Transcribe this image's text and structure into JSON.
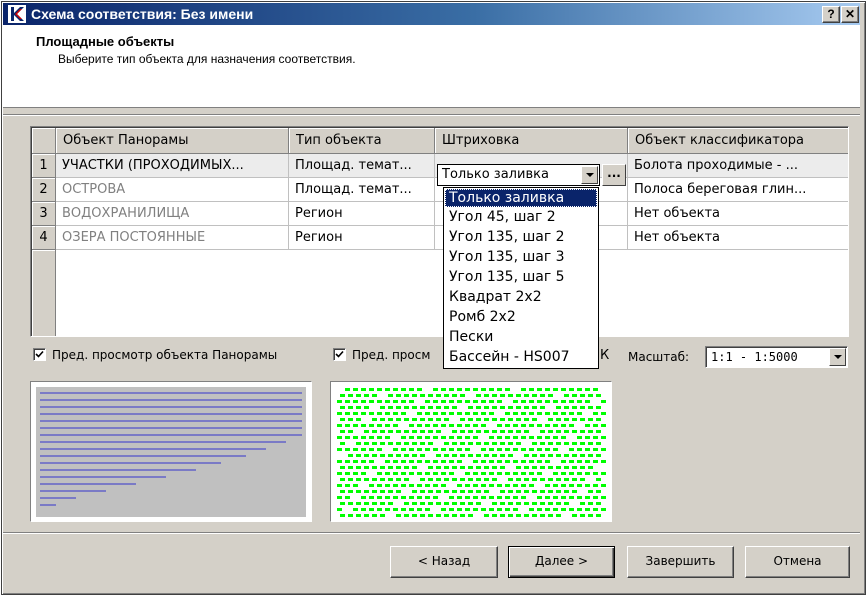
{
  "window": {
    "title": "Схема соответствия: Без имени",
    "help_label": "?",
    "close_label": "✕"
  },
  "header": {
    "title": "Площадные объекты",
    "subtitle": "Выберите тип объекта для назначения соответствия."
  },
  "grid": {
    "columns": [
      "Объект Панорамы",
      "Тип объекта",
      "Штриховка",
      "Объект классификатора"
    ],
    "rows": [
      {
        "num": "1",
        "object": "УЧАСТКИ (ПРОХОДИМЫХ...",
        "type": "Площад. темат...",
        "hatch": "Только заливка",
        "classifier": "Болота проходимые - ..."
      },
      {
        "num": "2",
        "object": "ОСТРОВА",
        "type": "Площад. темат...",
        "hatch": "",
        "classifier": "Полоса береговая глин..."
      },
      {
        "num": "3",
        "object": "ВОДОХРАНИЛИЩА",
        "type": "Регион",
        "hatch": "",
        "classifier": "Нет объекта"
      },
      {
        "num": "4",
        "object": "ОЗЕРА ПОСТОЯННЫЕ",
        "type": "Регион",
        "hatch": "",
        "classifier": "Нет объекта"
      }
    ],
    "combo_value": "Только заливка",
    "dots_label": "...",
    "dropdown_options": [
      "Только заливка",
      "Угол 45, шаг 2",
      "Угол 135, шаг 2",
      "Угол 135, шаг 3",
      "Угол 135, шаг 5",
      "Квадрат 2x2",
      "Ромб 2x2",
      "Пески",
      "Бассейн - HS007"
    ]
  },
  "preview": {
    "check1_label": "Пред. просмотр объекта Панорамы",
    "check2_label": "Пред. просм",
    "trailing_label": "К",
    "scale_label": "Масштаб:",
    "scale_value": "1:1 - 1:5000",
    "hatch_color": "#00ff00",
    "line_color": "#3333cc"
  },
  "buttons": {
    "back": "< Назад",
    "next": "Далее >",
    "finish": "Завершить",
    "cancel": "Отмена"
  }
}
